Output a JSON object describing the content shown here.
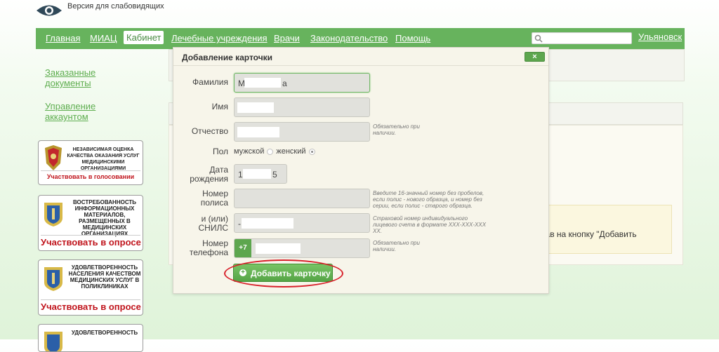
{
  "top": {
    "low_vision_label": "Версия для слабовидящих"
  },
  "nav": {
    "items": [
      "Главная",
      "МИАЦ",
      "Кабинет",
      "Лечебные учреждения",
      "Врачи",
      "Законодательство",
      "Помощь"
    ],
    "active": "Кабинет",
    "search_placeholder": "",
    "city": "Ульяновск"
  },
  "sidebar": {
    "links": [
      "Заказанные документы",
      "Управление аккаунтом"
    ]
  },
  "banners": [
    {
      "text": "Независимая оценка качества оказания услуг медицинскими организациями",
      "cta": "Участвовать в голосовании"
    },
    {
      "text": "Востребованность информационных материалов, размещенных в медицинских организациях",
      "cta": "Участвовать в опросе"
    },
    {
      "text": "Удовлетворенность населения качеством медицинских услуг в поликлиниках",
      "cta": "Участвовать в опросе"
    },
    {
      "text": "Удовлетворенность",
      "cta": ""
    }
  ],
  "background": {
    "partial_text": "кав на кнопку \"Добавить"
  },
  "modal": {
    "title": "Добавление карточки",
    "close_label": "×",
    "fields": {
      "surname": {
        "label": "Фамилия",
        "value_start": "М",
        "value_end": "а"
      },
      "name": {
        "label": "Имя"
      },
      "patronymic": {
        "label": "Отчество",
        "hint": "Обязательно при наличии."
      },
      "sex": {
        "label": "Пол",
        "options": [
          "мужской",
          "женский"
        ],
        "selected": "женский"
      },
      "birthdate": {
        "label": "Дата рождения",
        "value_start": "1",
        "value_end": "5"
      },
      "policy": {
        "label": "Номер полиса",
        "hint": "Введите 16-значный номер без пробелов, если полис - нового образца, и номер без серии, если полис - старого образца."
      },
      "snils": {
        "label": "и (или) СНИЛС",
        "value_start": "-",
        "hint": "Страховой номер индивидуального лицевого счета в формате XXX-XXX-XXX XX."
      },
      "phone": {
        "label": "Номер телефона",
        "prefix": "+7",
        "hint": "Обязательно при наличии."
      }
    },
    "submit_label": "Добавить карточку"
  }
}
